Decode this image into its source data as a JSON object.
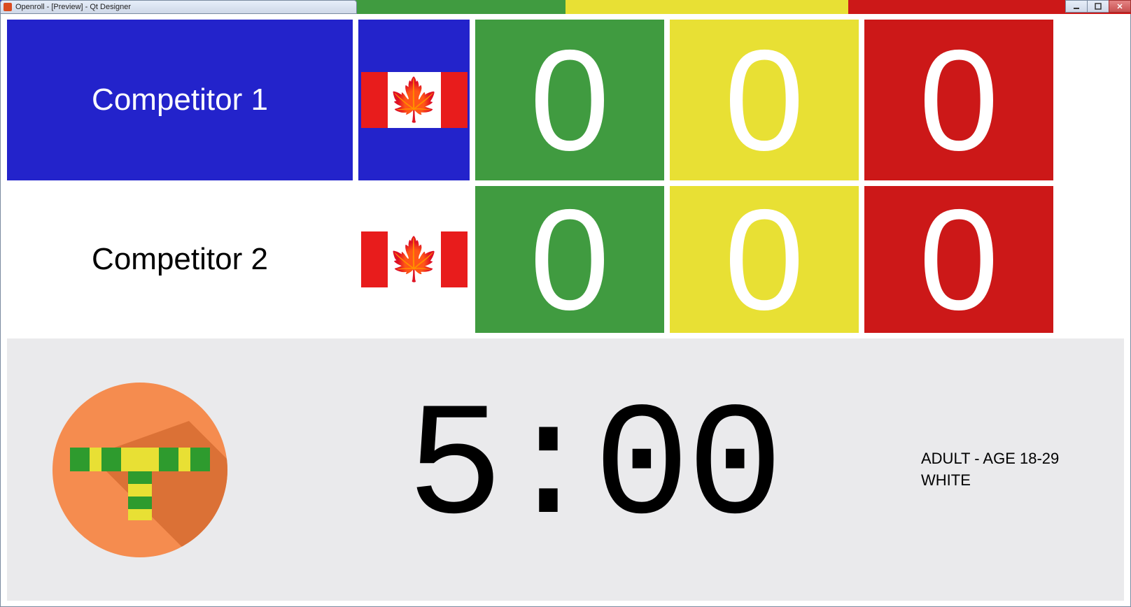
{
  "window": {
    "title": "Openroll - [Preview] - Qt Designer"
  },
  "competitors": [
    {
      "name": "Competitor 1",
      "flag": "canada",
      "points": "0",
      "advantages": "0",
      "penalties": "0"
    },
    {
      "name": "Competitor 2",
      "flag": "canada",
      "points": "0",
      "advantages": "0",
      "penalties": "0"
    }
  ],
  "timer": "5:00",
  "division": {
    "line1": "ADULT - AGE 18-29",
    "line2": "WHITE"
  }
}
